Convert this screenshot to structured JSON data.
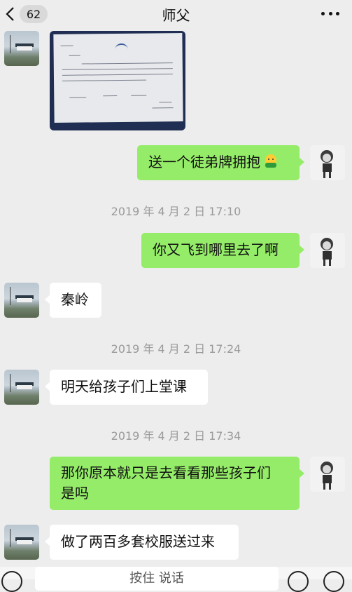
{
  "header": {
    "unread_count": "62",
    "title": "师父"
  },
  "messages": [
    {
      "type": "image",
      "from": "contact",
      "content": "handwritten letter photo"
    },
    {
      "type": "text",
      "from": "me",
      "text": "送一个徒弟牌拥抱",
      "emoji": "hug-emoji"
    },
    {
      "type": "time",
      "text": "2019 年 4 月 2 日 17:10"
    },
    {
      "type": "text",
      "from": "me",
      "text": "你又飞到哪里去了啊"
    },
    {
      "type": "text",
      "from": "contact",
      "text": "秦岭"
    },
    {
      "type": "time",
      "text": "2019 年 4 月 2 日 17:24"
    },
    {
      "type": "text",
      "from": "contact",
      "text": "明天给孩子们上堂课"
    },
    {
      "type": "time",
      "text": "2019 年 4 月 2 日 17:34"
    },
    {
      "type": "text",
      "from": "me",
      "line1": "那你原本就只是去看看那些孩子们",
      "line2": "是吗"
    },
    {
      "type": "text",
      "from": "contact",
      "text": "做了两百多套校服送过来"
    }
  ],
  "input_bar": {
    "placeholder_partial": "按住 说话"
  },
  "colors": {
    "background": "#ededed",
    "outgoing_bubble": "#95ec69",
    "incoming_bubble": "#ffffff",
    "timestamp": "#9a9a9a"
  }
}
